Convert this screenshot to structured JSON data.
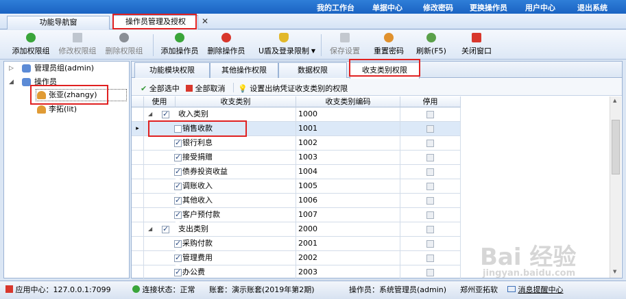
{
  "topbar": {
    "menu": [
      "我的工作台",
      "单据中心",
      "修改密码",
      "更换操作员",
      "用户中心",
      "退出系统"
    ]
  },
  "tabs": [
    {
      "label": "功能导航窗",
      "active": false
    },
    {
      "label": "操作员管理及授权",
      "active": true
    }
  ],
  "toolbar": [
    {
      "label": "添加权限组",
      "enabled": true,
      "icon": "add-icon"
    },
    {
      "label": "修改权限组",
      "enabled": false,
      "icon": "edit-icon"
    },
    {
      "label": "删除权限组",
      "enabled": false,
      "icon": "delete-icon"
    },
    {
      "label": "添加操作员",
      "enabled": true,
      "icon": "add-icon"
    },
    {
      "label": "删除操作员",
      "enabled": true,
      "icon": "delete-icon"
    },
    {
      "label": "U盾及登录限制",
      "enabled": true,
      "icon": "shield-icon"
    },
    {
      "label": "保存设置",
      "enabled": false,
      "icon": "save-icon"
    },
    {
      "label": "重置密码",
      "enabled": true,
      "icon": "key-icon"
    },
    {
      "label": "刷新(F5)",
      "enabled": true,
      "icon": "refresh-icon"
    },
    {
      "label": "关闭窗口",
      "enabled": true,
      "icon": "close-icon"
    }
  ],
  "tree": {
    "groups": [
      {
        "label": "管理员组(admin)",
        "expanded": false
      },
      {
        "label": "操作员",
        "expanded": true
      }
    ],
    "users": [
      {
        "label": "张亚(zhangy)",
        "selected": true
      },
      {
        "label": "李拓(lit)",
        "selected": false
      }
    ]
  },
  "subtabs": [
    {
      "label": "功能模块权限",
      "active": false
    },
    {
      "label": "其他操作权限",
      "active": false
    },
    {
      "label": "数据权限",
      "active": false
    },
    {
      "label": "收支类别权限",
      "active": true
    }
  ],
  "actions": {
    "select_all": "全部选中",
    "deselect_all": "全部取消",
    "voucher_setting": "设置出纳凭证收支类别的权限"
  },
  "grid": {
    "headers": [
      "使用",
      "收支类别",
      "收支类别编码",
      "停用"
    ],
    "rows": [
      {
        "name": "收入类别",
        "code": "1000",
        "used": true,
        "level": 0
      },
      {
        "name": "销售收款",
        "code": "1001",
        "used": false,
        "level": 1,
        "current": true
      },
      {
        "name": "银行利息",
        "code": "1002",
        "used": true,
        "level": 1
      },
      {
        "name": "接受捐赠",
        "code": "1003",
        "used": true,
        "level": 1
      },
      {
        "name": "债券投资收益",
        "code": "1004",
        "used": true,
        "level": 1
      },
      {
        "name": "调账收入",
        "code": "1005",
        "used": true,
        "level": 1
      },
      {
        "name": "其他收入",
        "code": "1006",
        "used": true,
        "level": 1
      },
      {
        "name": "客户预付款",
        "code": "1007",
        "used": true,
        "level": 1
      },
      {
        "name": "支出类别",
        "code": "2000",
        "used": true,
        "level": 0
      },
      {
        "name": "采购付款",
        "code": "2001",
        "used": true,
        "level": 1
      },
      {
        "name": "管理费用",
        "code": "2002",
        "used": true,
        "level": 1
      },
      {
        "name": "办公费",
        "code": "2003",
        "used": true,
        "level": 1
      }
    ]
  },
  "status": {
    "app_center": "应用中心：127.0.0.1:7099",
    "connection": "连接状态：正常",
    "account": "账套：演示账套(2019年第2期)",
    "operator": "操作员：系统管理员(admin)",
    "company": "郑州亚拓软",
    "message": "消息提醒中心"
  },
  "watermark": {
    "logo": "Bai 经验",
    "url": "jingyan.baidu.com"
  },
  "colors": {
    "topbar": "#1f6cca",
    "highlight": "#e02020",
    "selected_row": "#dce9f8"
  }
}
